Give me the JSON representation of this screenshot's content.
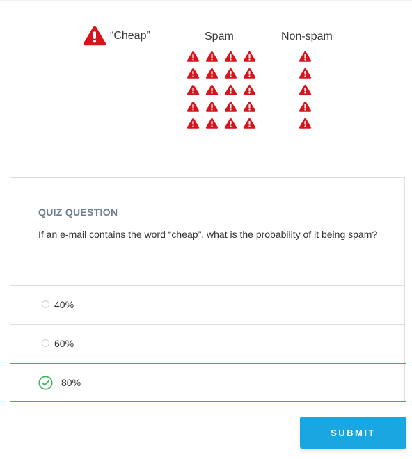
{
  "illustration": {
    "cheap_label": "“Cheap”",
    "spam_label": "Spam",
    "nonspam_label": "Non-spam",
    "spam_count": 20,
    "nonspam_count": 5,
    "icon": "warning-triangle-icon",
    "icon_color": "#d7141b"
  },
  "quiz": {
    "tag": "QUIZ QUESTION",
    "question": "If an e-mail contains the word “cheap”, what is the probability of it being spam?",
    "options": [
      {
        "label": "40%",
        "selected": false,
        "correct": false
      },
      {
        "label": "60%",
        "selected": false,
        "correct": false
      },
      {
        "label": "80%",
        "selected": true,
        "correct": true
      }
    ],
    "correct_color": "#3fb35c"
  },
  "submit": {
    "label": "SUBMIT",
    "color": "#1aa6e0"
  }
}
